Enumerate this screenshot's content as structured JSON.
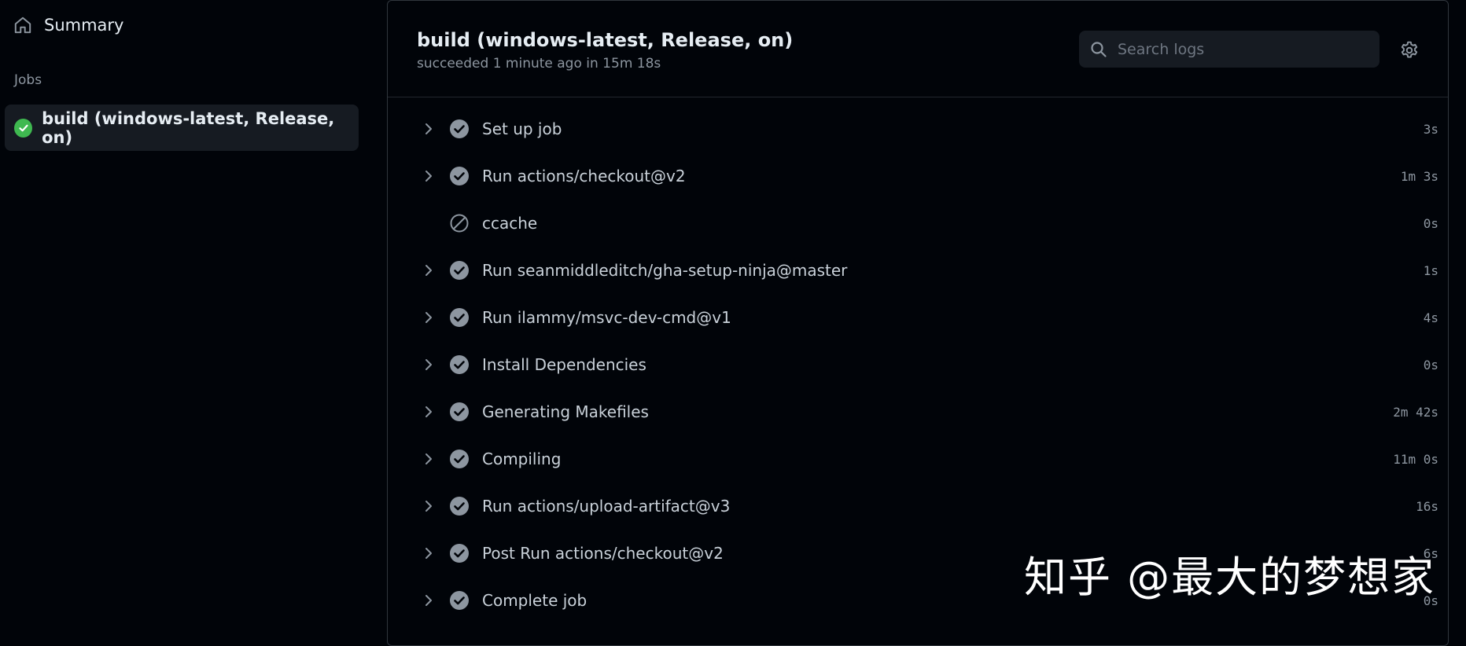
{
  "sidebar": {
    "summary_label": "Summary",
    "jobs_heading": "Jobs",
    "jobs": [
      {
        "label": "build (windows-latest, Release, on)",
        "status": "success",
        "icon": "check-circle-fill-icon"
      }
    ]
  },
  "job": {
    "title": "build (windows-latest, Release, on)",
    "subtitle": "succeeded 1 minute ago in 15m 18s"
  },
  "search": {
    "placeholder": "Search logs",
    "value": ""
  },
  "steps": [
    {
      "name": "Set up job",
      "duration": "3s",
      "status": "success",
      "expandable": true
    },
    {
      "name": "Run actions/checkout@v2",
      "duration": "1m 3s",
      "status": "success",
      "expandable": true
    },
    {
      "name": "ccache",
      "duration": "0s",
      "status": "skipped",
      "expandable": false
    },
    {
      "name": "Run seanmiddleditch/gha-setup-ninja@master",
      "duration": "1s",
      "status": "success",
      "expandable": true
    },
    {
      "name": "Run ilammy/msvc-dev-cmd@v1",
      "duration": "4s",
      "status": "success",
      "expandable": true
    },
    {
      "name": "Install Dependencies",
      "duration": "0s",
      "status": "success",
      "expandable": true
    },
    {
      "name": "Generating Makefiles",
      "duration": "2m 42s",
      "status": "success",
      "expandable": true
    },
    {
      "name": "Compiling",
      "duration": "11m 0s",
      "status": "success",
      "expandable": true
    },
    {
      "name": "Run actions/upload-artifact@v3",
      "duration": "16s",
      "status": "success",
      "expandable": true
    },
    {
      "name": "Post Run actions/checkout@v2",
      "duration": "6s",
      "status": "success",
      "expandable": true
    },
    {
      "name": "Complete job",
      "duration": "0s",
      "status": "success",
      "expandable": true
    }
  ],
  "watermark": "知乎 @最大的梦想家",
  "colors": {
    "success": "#3fb950",
    "step_icon": "#8d96a0",
    "background": "#010409",
    "panel": "#161b22"
  }
}
